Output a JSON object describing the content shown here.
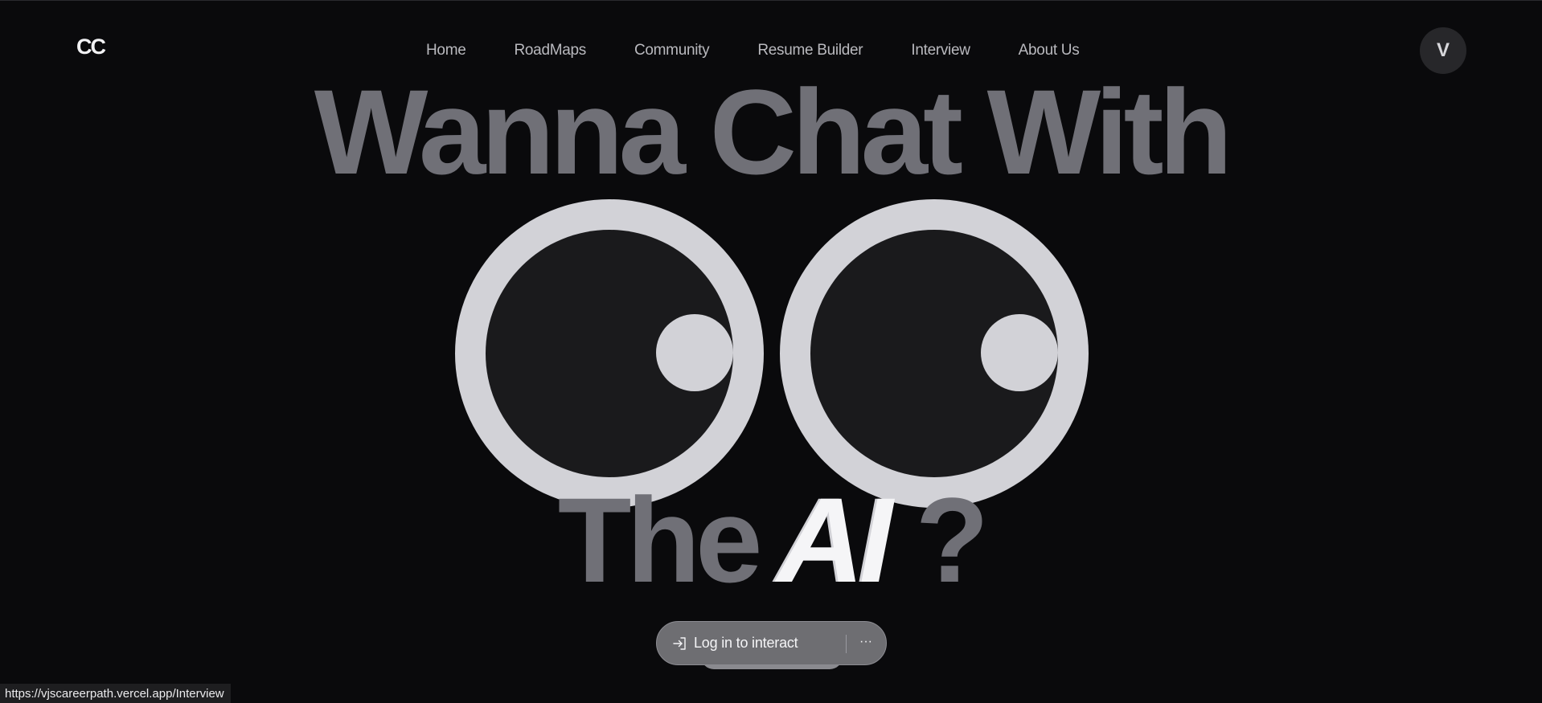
{
  "header": {
    "logo": "CC",
    "nav": [
      "Home",
      "RoadMaps",
      "Community",
      "Resume Builder",
      "Interview",
      "About Us"
    ],
    "avatar_initial": "V"
  },
  "hero": {
    "line1": "Wanna Chat With",
    "line2_the": "The",
    "line2_ai": "AI",
    "line2_q": "?",
    "eyes": [
      "left-eye",
      "right-eye"
    ]
  },
  "cta": {
    "login_label": "Log in to interact",
    "login_icon": "login-arrow-icon",
    "more_icon": "more-horizontal-icon",
    "more_glyph": "···"
  },
  "status_bar": {
    "url": "https://vjscareerpath.vercel.app/Interview"
  },
  "colors": {
    "background": "#0a0a0c",
    "headline_gray": "#707077",
    "eye_white": "#d2d2d7",
    "eye_socket": "#1a1a1c",
    "ai_white": "#f5f5f7"
  }
}
